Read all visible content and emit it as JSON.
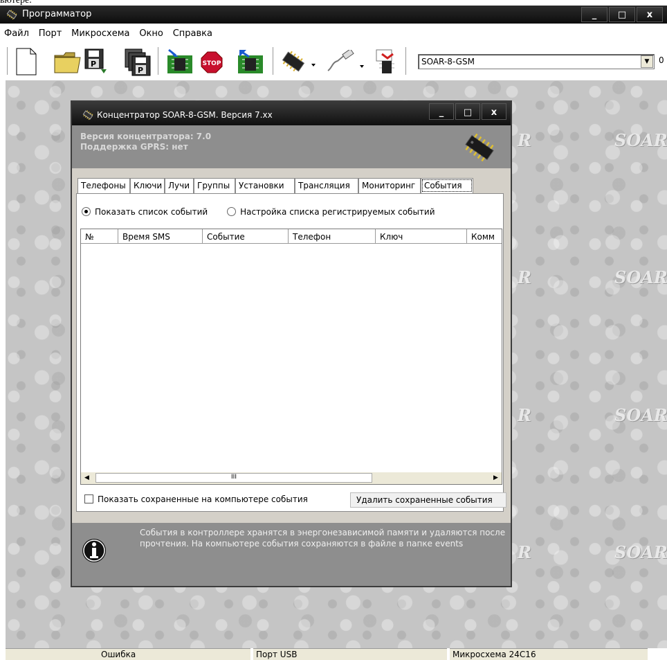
{
  "top_fragment": "ьютере.",
  "app": {
    "title": "Программатор"
  },
  "window_controls": {
    "minimize": "_",
    "maximize": "□",
    "close": "x"
  },
  "menu": [
    "Файл",
    "Порт",
    "Микросхема",
    "Окно",
    "Справка"
  ],
  "toolbar": {
    "device_combo": "SOAR-8-GSM",
    "extra": "0",
    "stop_label": "STOP"
  },
  "workspace": {
    "logo_text": "SOAR",
    "logo_fragment": "R"
  },
  "child": {
    "title": "Концентратор SOAR-8-GSM. Версия 7.xx",
    "version_line": "Версия концентратора: 7.0",
    "gprs_line": "Поддержка GPRS: нет",
    "tabs": [
      "Телефоны",
      "Ключи",
      "Лучи",
      "Группы",
      "Установки",
      "Трансляция",
      "Мониторинг",
      "События"
    ],
    "active_tab": "События",
    "radio_show": "Показать список событий",
    "radio_config": "Настройка списка регистрируемых событий",
    "columns": [
      "№",
      "Время SMS",
      "Событие",
      "Телефон",
      "Ключ",
      "Комм"
    ],
    "scroll_grip": "III",
    "checkbox_label": "Показать сохраненные на компьютере события",
    "delete_button": "Удалить сохраненные события",
    "help_text": "События в контроллере хранятся в энергонезависимой памяти и удаляются после прочтения. На компьютере события сохраняются в файле в папке events"
  },
  "status": {
    "error": "Ошибка",
    "port": "Порт USB",
    "chip": "Микросхема 24C16"
  }
}
